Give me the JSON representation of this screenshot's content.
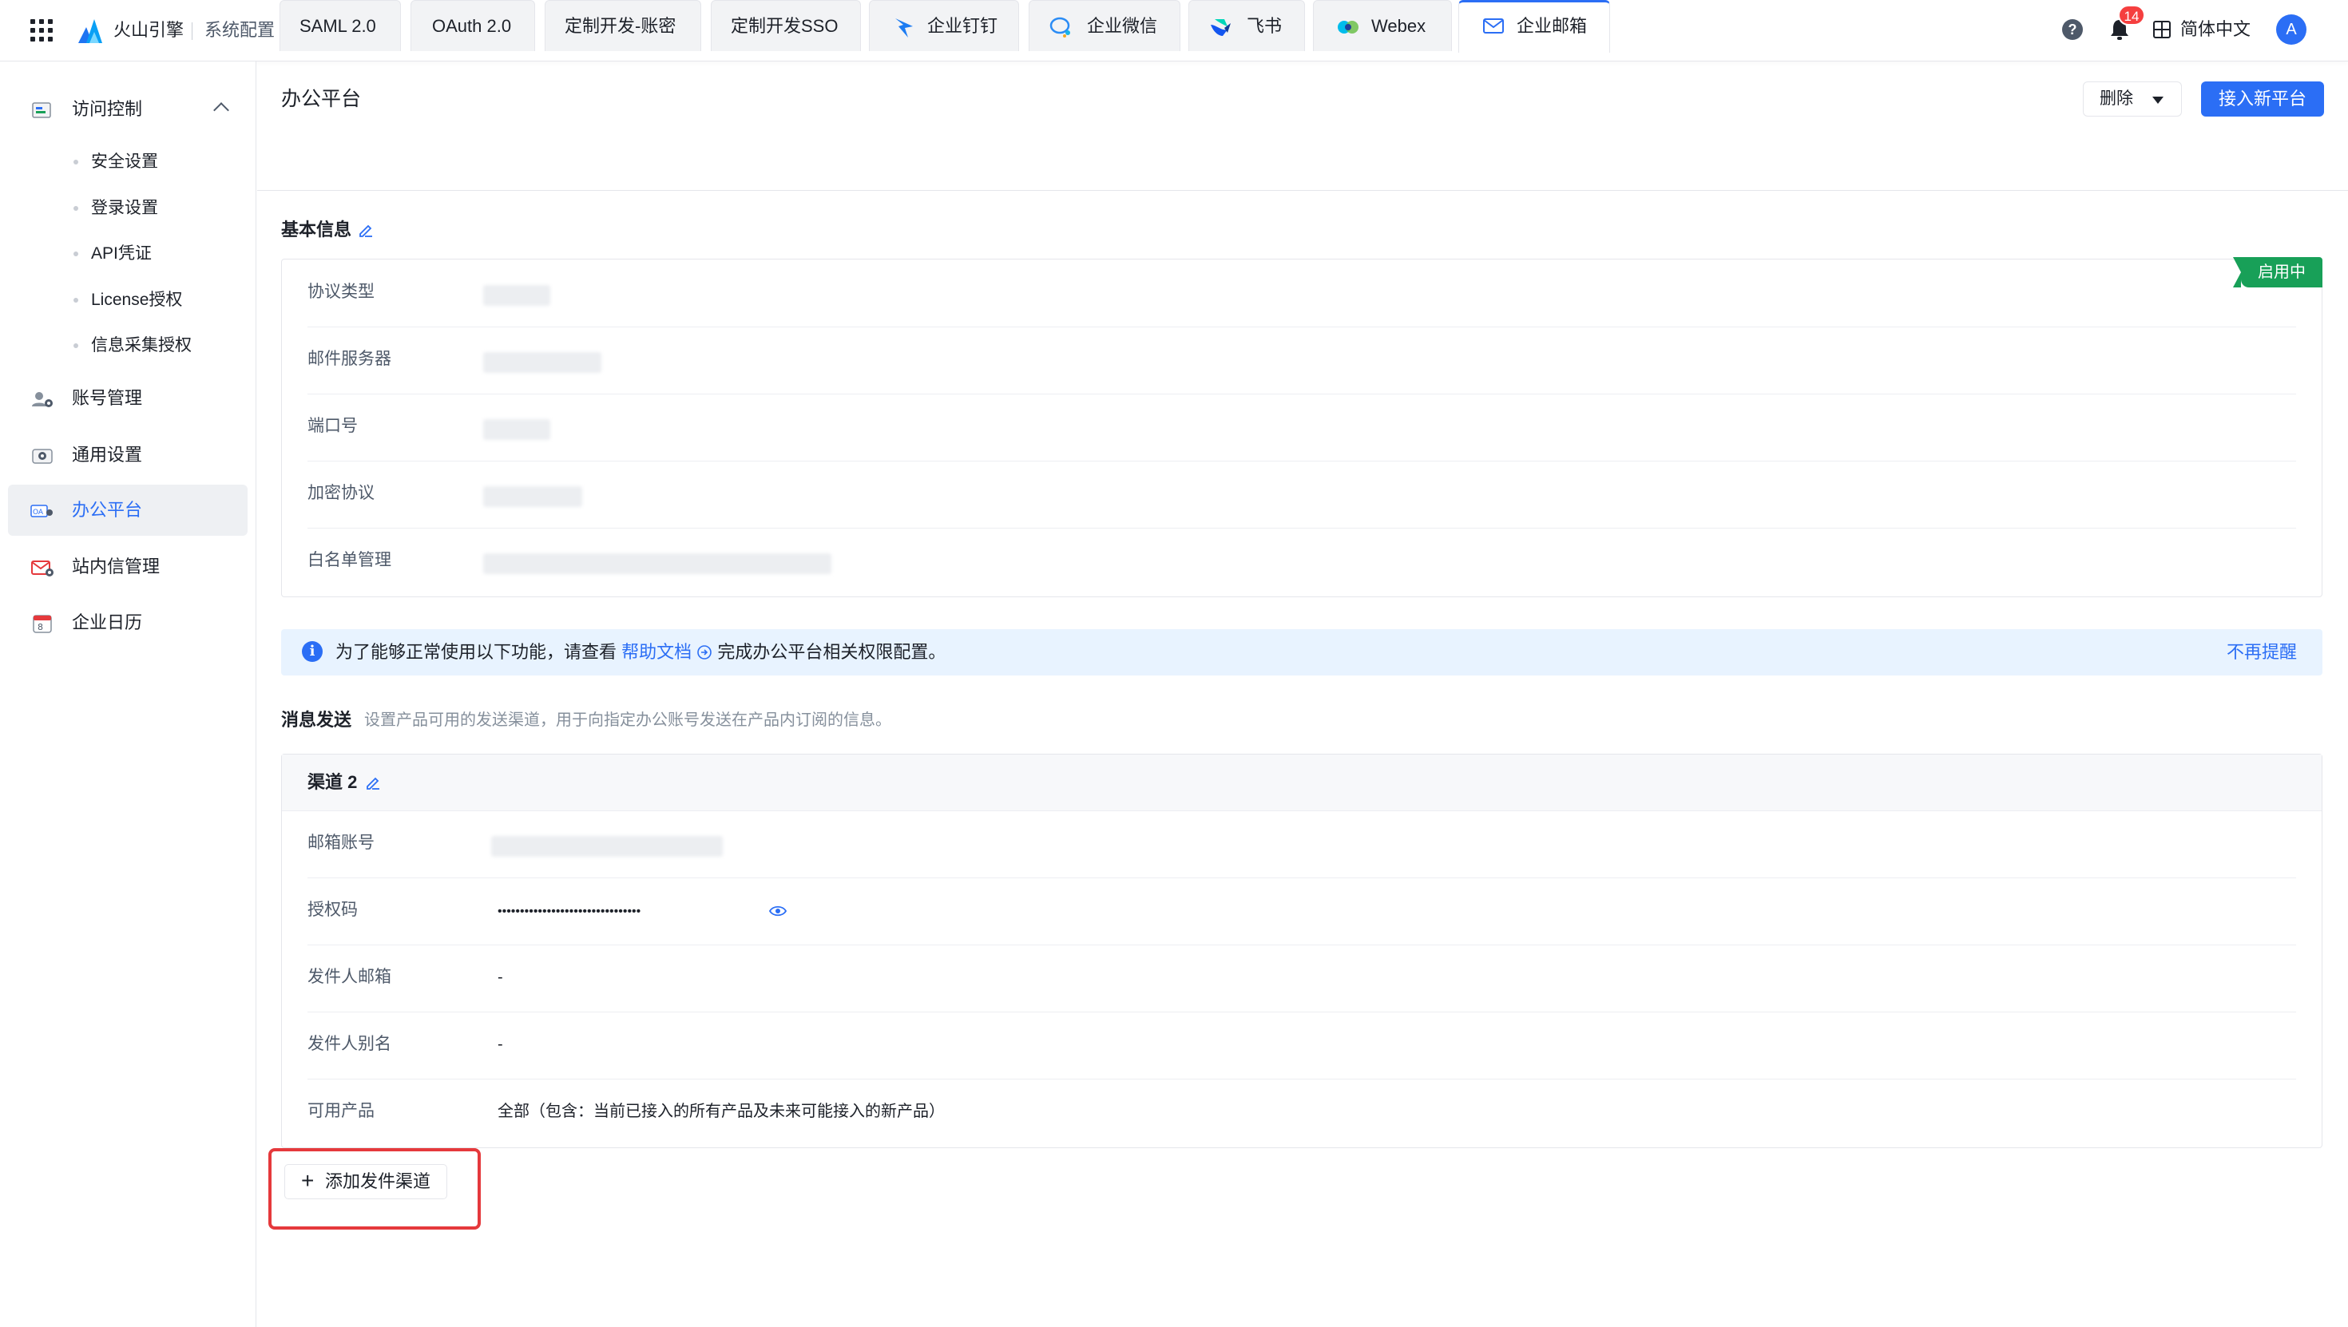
{
  "header": {
    "brand": "火山引擎",
    "subtitle": "系统配置",
    "notification_count": "14",
    "language": "简体中文",
    "avatar_initial": "A"
  },
  "sidebar": {
    "groups": [
      {
        "label": "访问控制",
        "icon": "access-control-icon",
        "expanded": true,
        "children": [
          {
            "label": "安全设置"
          },
          {
            "label": "登录设置"
          },
          {
            "label": "API凭证"
          },
          {
            "label": "License授权"
          },
          {
            "label": "信息采集授权"
          }
        ]
      },
      {
        "label": "账号管理",
        "icon": "account-settings-icon"
      },
      {
        "label": "通用设置",
        "icon": "general-settings-icon"
      },
      {
        "label": "办公平台",
        "icon": "office-platform-icon",
        "active": true
      },
      {
        "label": "站内信管理",
        "icon": "mail-settings-icon"
      },
      {
        "label": "企业日历",
        "icon": "calendar-icon"
      }
    ]
  },
  "main": {
    "title": "办公平台",
    "delete_label": "删除",
    "primary_label": "接入新平台",
    "tabs": [
      {
        "label": "SAML 2.0"
      },
      {
        "label": "OAuth 2.0"
      },
      {
        "label": "定制开发-账密"
      },
      {
        "label": "定制开发SSO"
      },
      {
        "label": "企业钉钉",
        "icon": "dingtalk-icon"
      },
      {
        "label": "企业微信",
        "icon": "wecom-icon"
      },
      {
        "label": "飞书",
        "icon": "feishu-icon"
      },
      {
        "label": "Webex",
        "icon": "webex-icon"
      },
      {
        "label": "企业邮箱",
        "icon": "mail-icon",
        "active": true
      }
    ],
    "basic_info": {
      "title": "基本信息",
      "status": "启用中",
      "rows": [
        {
          "label": "协议类型"
        },
        {
          "label": "邮件服务器"
        },
        {
          "label": "端口号"
        },
        {
          "label": "加密协议"
        },
        {
          "label": "白名单管理"
        }
      ]
    },
    "notice": {
      "text_before": "为了能够正常使用以下功能，请查看",
      "link": "帮助文档",
      "text_after": "完成办公平台相关权限配置。",
      "dismiss": "不再提醒"
    },
    "messaging": {
      "title": "消息发送",
      "description": "设置产品可用的发送渠道，用于向指定办公账号发送在产品内订阅的信息。",
      "channel": {
        "title": "渠道 2",
        "rows": [
          {
            "label": "邮箱账号",
            "value": ""
          },
          {
            "label": "授权码",
            "value": "••••••••••••••••••••••••••••••••"
          },
          {
            "label": "发件人邮箱",
            "value": "-"
          },
          {
            "label": "发件人别名",
            "value": "-"
          },
          {
            "label": "可用产品",
            "value": "全部（包含：当前已接入的所有产品及未来可能接入的新产品）"
          }
        ]
      },
      "add_label": "添加发件渠道"
    }
  },
  "colors": {
    "accent": "#2b6ef5",
    "success": "#18a058",
    "danger": "#e5393c"
  }
}
